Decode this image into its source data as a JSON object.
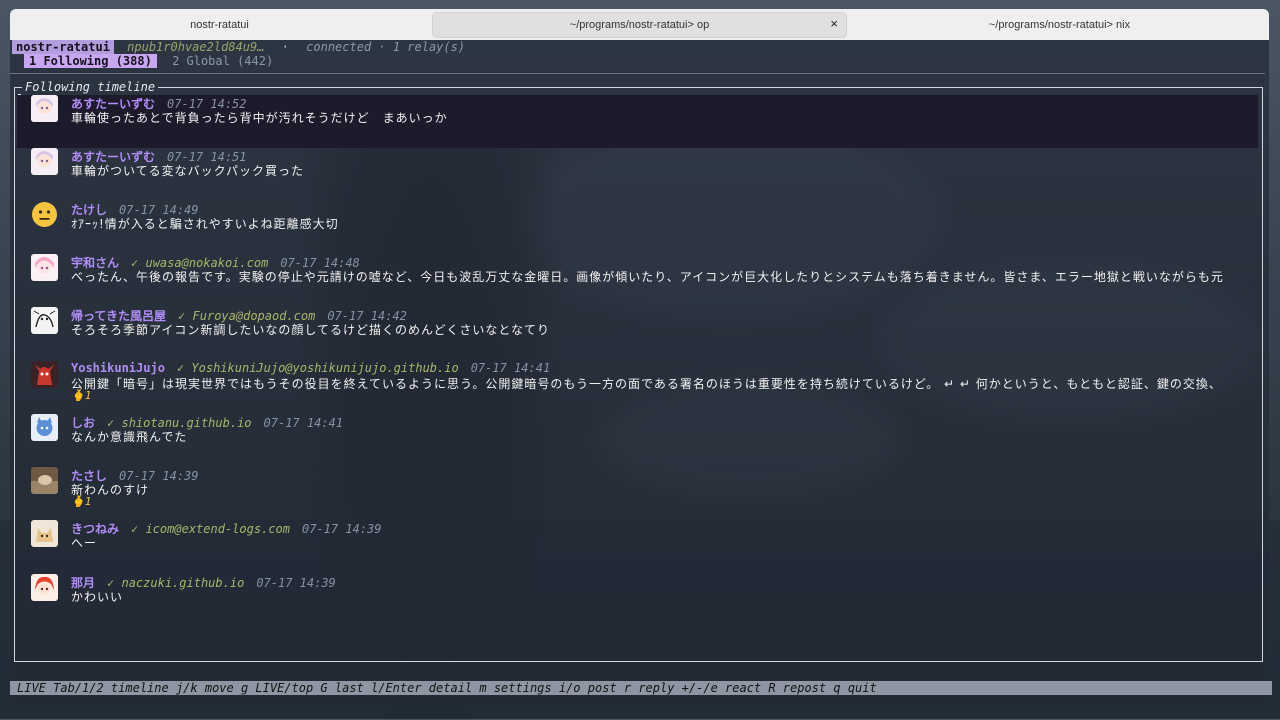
{
  "tabs": [
    {
      "label": "nostr-ratatui",
      "active": false
    },
    {
      "label": "~/programs/nostr-ratatui> op",
      "active": true
    },
    {
      "label": "~/programs/nostr-ratatui> nix",
      "active": false
    }
  ],
  "tab_close_glyph": "×",
  "header": {
    "app_name": "nostr-ratatui",
    "npub": "npub1r0hvae2ld84u9…",
    "separator": "·",
    "status": "connected · 1 relay(s)"
  },
  "timeline_tabs": {
    "following": "1 Following (388)",
    "global": "2 Global (442)"
  },
  "panel_title": "Following timeline",
  "posts": [
    {
      "name": "あすたーいずむ",
      "nip05": "",
      "time": "07-17 14:52",
      "body": "車輪使ったあとで背負ったら背中が汚れそうだけど　まあいっか",
      "reaction": "",
      "avatar_icon": "anime-avatar-icon",
      "selected": true
    },
    {
      "name": "あすたーいずむ",
      "nip05": "",
      "time": "07-17 14:51",
      "body": "車輪がついてる変なバックパック買った",
      "reaction": "",
      "avatar_icon": "anime-avatar-icon",
      "selected": false
    },
    {
      "name": "たけし",
      "nip05": "",
      "time": "07-17 14:49",
      "body": "ｵｱｰｯ!情が入ると騙されやすいよね距離感大切",
      "reaction": "",
      "avatar_icon": "neutral-face-icon",
      "selected": false
    },
    {
      "name": "宇和さん",
      "nip05": "uwasa@nokakoi.com",
      "time": "07-17 14:48",
      "body": "べったん、午後の報告です。実験の停止や元請けの嘘など、今日も波乱万丈な金曜日。画像が傾いたり、アイコンが巨大化したりとシステムも落ち着きません。皆さま、エラー地獄と戦いながらも元",
      "reaction": "",
      "avatar_icon": "anime-avatar-icon",
      "selected": false
    },
    {
      "name": "帰ってきた風呂屋",
      "nip05": "Furoya@dopaod.com",
      "time": "07-17 14:42",
      "body": "そろそろ季節アイコン新調したいなの顔してるけど描くのめんどくさいなとなてり",
      "reaction": "",
      "avatar_icon": "sketch-avatar-icon",
      "selected": false
    },
    {
      "name": "YoshikuniJujo",
      "nip05": "YoshikuniJujo@yoshikunijujo.github.io",
      "time": "07-17 14:41",
      "body": "公開鍵「暗号」は現実世界ではもうその役目を終えているように思う。公開鍵暗号のもう一方の面である署名のほうは重要性を持ち続けているけど。 ↵ ↵ 何かというと、もともと認証、鍵の交換、",
      "reaction": "🫰1",
      "avatar_icon": "red-creature-icon",
      "selected": false
    },
    {
      "name": "しお",
      "nip05": "shiotanu.github.io",
      "time": "07-17 14:41",
      "body": "なんか意識飛んでた",
      "reaction": "",
      "avatar_icon": "blue-avatar-icon",
      "selected": false
    },
    {
      "name": "たさし",
      "nip05": "",
      "time": "07-17 14:39",
      "body": "新わんのすけ",
      "reaction": "🫰1",
      "avatar_icon": "photo-avatar-icon",
      "selected": false
    },
    {
      "name": "きつねみ",
      "nip05": "icom@extend-logs.com",
      "time": "07-17 14:39",
      "body": "へー",
      "reaction": "",
      "avatar_icon": "fox-avatar-icon",
      "selected": false
    },
    {
      "name": "那月",
      "nip05": "naczuki.github.io",
      "time": "07-17 14:39",
      "body": "かわいい",
      "reaction": "",
      "avatar_icon": "red-hair-avatar-icon",
      "selected": false
    }
  ],
  "nip05_check": "✓",
  "statusbar": "LIVE  Tab/1/2 timeline  j/k move  g LIVE/top  G last  l/Enter detail  m settings  i/o post  r reply  +/-/e react  R repost  q quit",
  "colors": {
    "accent": "#b29dde",
    "name": "#b08cf5",
    "nip05": "#a9b56a",
    "selected_bg": "#1d1a2c",
    "statusbar_bg": "#8e96a3"
  }
}
